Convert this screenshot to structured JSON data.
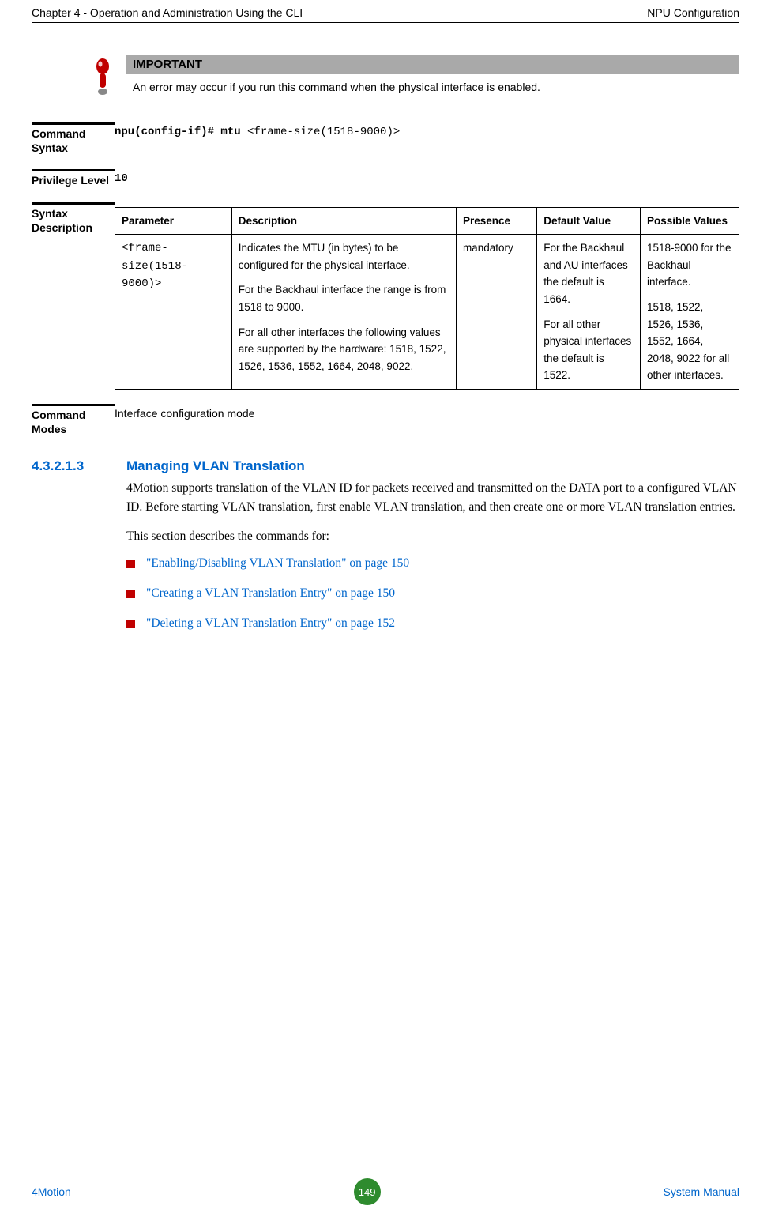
{
  "header": {
    "left": "Chapter 4 - Operation and Administration Using the CLI",
    "right": "NPU Configuration"
  },
  "important": {
    "label": "IMPORTANT",
    "body": "An error may occur if you run this command when the physical interface is enabled."
  },
  "command_syntax": {
    "label": "Command Syntax",
    "bold_part": "npu(config-if)# mtu ",
    "plain_part": "<frame-size(1518-9000)>"
  },
  "privilege": {
    "label": "Privilege Level",
    "value": "10"
  },
  "syntax_desc": {
    "label": "Syntax Description",
    "headers": {
      "parameter": "Parameter",
      "description": "Description",
      "presence": "Presence",
      "default_value": "Default Value",
      "possible_values": "Possible Values"
    },
    "row": {
      "parameter": "<frame-size(1518-9000)>",
      "desc_p1": "Indicates the MTU (in bytes) to be configured for the physical interface.",
      "desc_p2": "For the Backhaul interface the range is from 1518 to 9000.",
      "desc_p3": "For all other interfaces the following values are supported by the hardware: 1518, 1522, 1526, 1536, 1552,  1664, 2048, 9022.",
      "presence": "mandatory",
      "default_p1": "For the Backhaul and AU interfaces the default is 1664.",
      "default_p2": "For all other physical interfaces the default is 1522.",
      "possible_p1": "1518-9000 for the Backhaul interface.",
      "possible_p2": "1518, 1522, 1526, 1536, 1552, 1664, 2048, 9022 for all other interfaces."
    }
  },
  "command_modes": {
    "label": "Command Modes",
    "value": "Interface configuration mode"
  },
  "section": {
    "number": "4.3.2.1.3",
    "title": "Managing VLAN Translation",
    "p1": "4Motion supports translation of the VLAN ID for packets received and transmitted on the DATA port to a configured VLAN ID. Before starting VLAN translation, first enable VLAN translation, and then create one or more VLAN translation entries.",
    "p2": "This section describes the commands for:",
    "links": [
      "\"Enabling/Disabling VLAN Translation\" on page 150",
      "\"Creating a VLAN Translation Entry\" on page 150",
      "\"Deleting a VLAN Translation Entry\" on page 152"
    ]
  },
  "footer": {
    "left": "4Motion",
    "center": "149",
    "right": "System Manual"
  }
}
